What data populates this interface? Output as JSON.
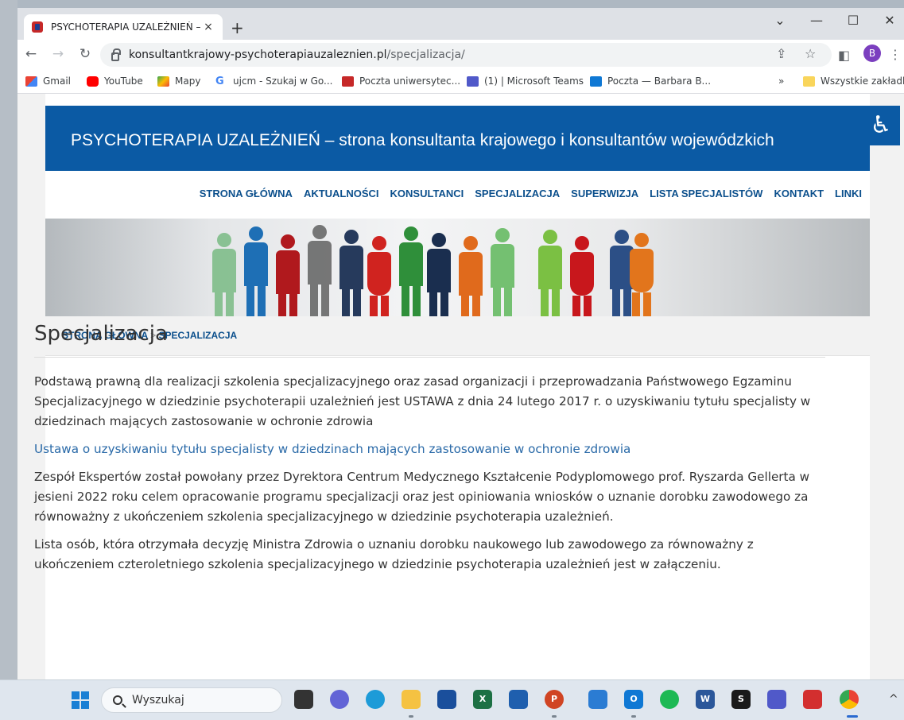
{
  "browser": {
    "tab_title": "PSYCHOTERAPIA UZALEŻNIEŃ –",
    "tab_close": "×",
    "new_tab": "+",
    "url_host": "konsultantkrajowy-psychoterapiauzaleznien.pl",
    "url_path": "/specjalizacja/",
    "profile_initial": "B",
    "accent": "#0b5aa4"
  },
  "bookmarks": {
    "items": [
      "Gmail",
      "YouTube",
      "Mapy",
      "ujcm - Szukaj w Go...",
      "Poczta uniwersytec...",
      "(1) | Microsoft Teams",
      "Poczta — Barbara B..."
    ],
    "overflow": "»",
    "all_bookmarks": "Wszystkie zakładki"
  },
  "site": {
    "header_title": "PSYCHOTERAPIA UZALEŻNIEŃ – strona konsultanta krajowego i konsultantów wojewódzkich",
    "menu": [
      "STRONA GŁÓWNA",
      "AKTUALNOŚCI",
      "KONSULTANCI",
      "SPECJALIZACJA",
      "SUPERWIZJA",
      "LISTA SPECJALISTÓW",
      "KONTAKT",
      "LINKI"
    ],
    "breadcrumb": {
      "home": "STRONA GŁÓWNA",
      "sep": ">",
      "current": "SPECJALIZACJA"
    }
  },
  "content": {
    "heading": "Specjalizacja",
    "p1": "Podstawą prawną dla realizacji szkolenia specjalizacyjnego oraz zasad organizacji i przeprowadzania Państwowego Egzaminu Specjalizacyjnego w dziedzinie psychoterapii uzależnień jest USTAWA z dnia 24 lutego 2017 r. o uzyskiwaniu tytułu specjalisty w dziedzinach mających zastosowanie w ochronie zdrowia",
    "link": "Ustawa o uzyskiwaniu tytułu specjalisty w dziedzinach mających zastosowanie w ochronie zdrowia",
    "p2": "Zespół Ekspertów został powołany przez Dyrektora Centrum Medycznego Kształcenie Podyplomowego prof. Ryszarda Gellerta w jesieni 2022 roku celem opracowanie programu specjalizacji oraz jest opiniowania wniosków o uznanie dorobku zawodowego za równoważny z ukończeniem szkolenia specjalizacyjnego w dziedzinie psychoterapia uzależnień.",
    "p3": "Lista osób, która otrzymała decyzję Ministra Zdrowia o uznaniu dorobku naukowego lub zawodowego za równoważny z ukończeniem czteroletniego szkolenia specjalizacyjnego w dziedzinie psychoterapia uzależnień jest w załączeniu."
  },
  "taskbar": {
    "search_placeholder": "Wyszukaj"
  }
}
